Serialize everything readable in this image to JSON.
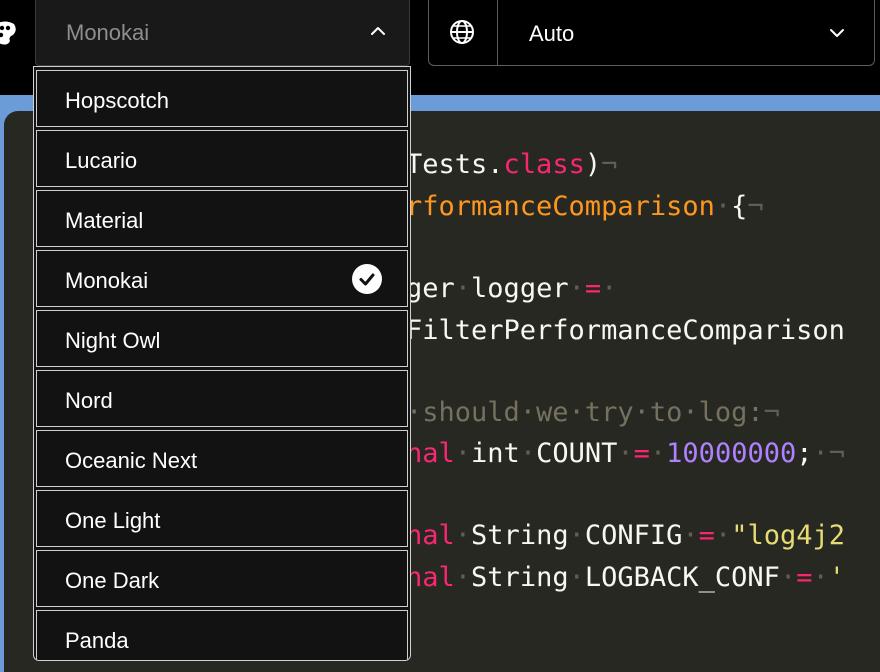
{
  "toolbar": {
    "theme_select": {
      "value": "Monokai",
      "icon": "chevron-up-icon"
    },
    "language_select": {
      "value": "Auto",
      "icon": "chevron-down-icon",
      "leading_icon": "globe-icon"
    },
    "palette_icon": "palette-icon"
  },
  "dropdown": {
    "options": [
      {
        "label": "Hopscotch",
        "selected": false
      },
      {
        "label": "Lucario",
        "selected": false
      },
      {
        "label": "Material",
        "selected": false
      },
      {
        "label": "Monokai",
        "selected": true
      },
      {
        "label": "Night Owl",
        "selected": false
      },
      {
        "label": "Nord",
        "selected": false
      },
      {
        "label": "Oceanic Next",
        "selected": false
      },
      {
        "label": "One Light",
        "selected": false
      },
      {
        "label": "One Dark",
        "selected": false
      },
      {
        "label": "Panda",
        "selected": false
      }
    ],
    "check_icon": "checkmark-circle-icon"
  },
  "code": {
    "l1": {
      "a": "Tests.",
      "b": "class",
      "c": ")",
      "d": "¬"
    },
    "l2": {
      "a": "rformanceComparison",
      "b": "·",
      "c": "{",
      "d": "¬"
    },
    "l3": {
      "a": "ger",
      "b": "·",
      "c": "logger",
      "d": "·",
      "e": "=",
      "f": "·"
    },
    "l4": {
      "a": "FilterPerformanceComparison"
    },
    "l5": {
      "a": "·should·we·try·to·log:",
      "b": "¬"
    },
    "l6": {
      "a": "nal",
      "b": "·",
      "c": "int",
      "d": "·",
      "e": "COUNT",
      "f": "·",
      "g": "=",
      "h": "·",
      "i": "10000000",
      "j": ";",
      "k": "·",
      "l": "¬"
    },
    "l7": {
      "a": "nal",
      "b": "·",
      "c": "String",
      "d": "·",
      "e": "CONFIG",
      "f": "·",
      "g": "=",
      "h": "·",
      "i": "\"log4j2"
    },
    "l8": {
      "a": "nal",
      "b": "·",
      "c": "String",
      "d": "·",
      "e": "LOGBACK_CONF",
      "f": "·",
      "g": "=",
      "h": "·",
      "i": "'"
    }
  },
  "colors": {
    "frame": "#6b9bd9",
    "editor_bg": "#272822",
    "keyword": "#f92672",
    "class_name": "#fd971f",
    "number": "#ae81ff",
    "string": "#e6db74",
    "comment": "#75715e"
  }
}
